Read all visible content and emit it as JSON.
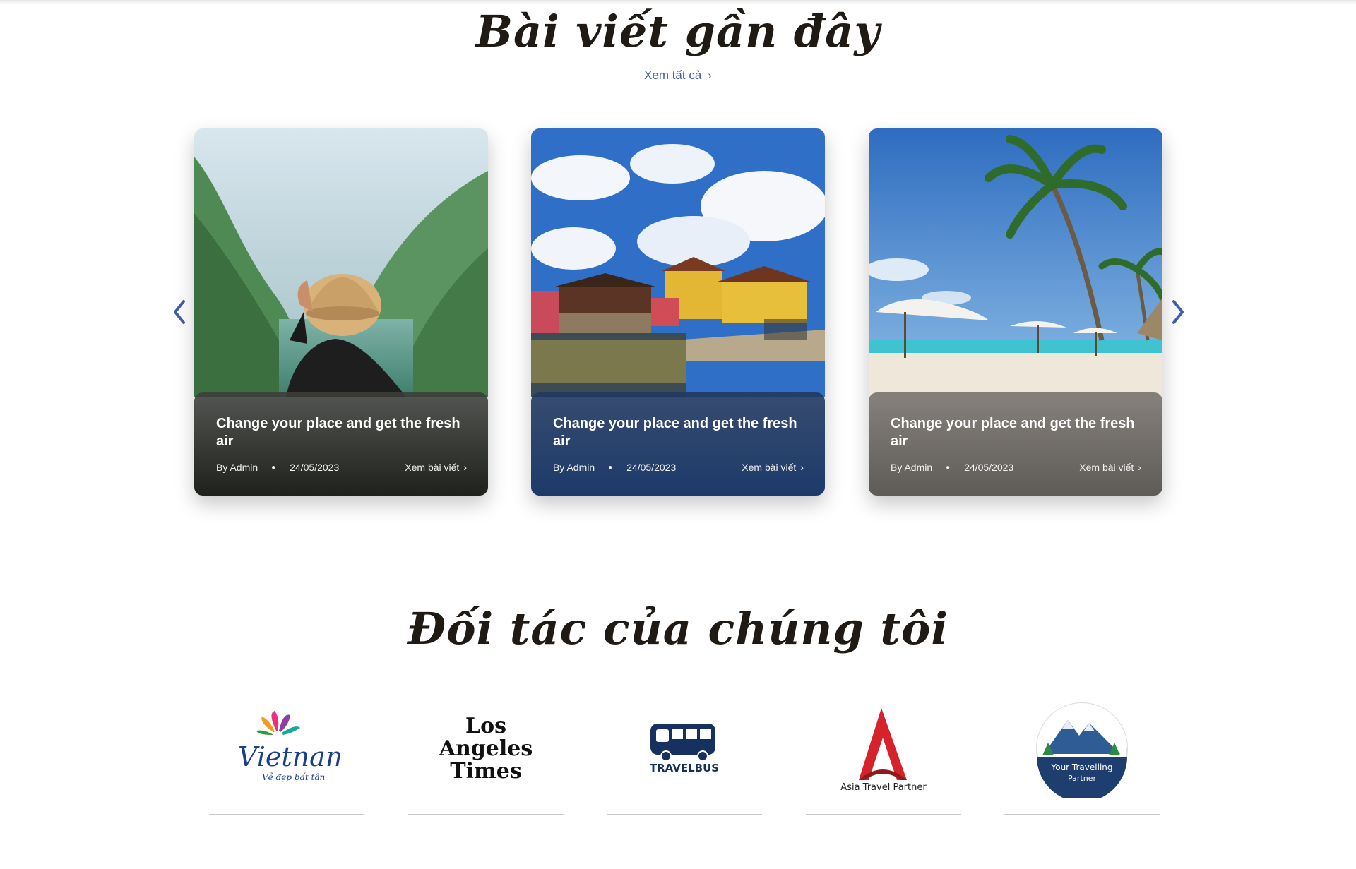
{
  "recent_posts": {
    "title": "Bài viết gần đây",
    "view_all": "Xem tất cả",
    "posts": [
      {
        "title": "Change your place and get the fresh air",
        "author": "By Admin",
        "date": "24/05/2023",
        "read_more": "Xem bài viết"
      },
      {
        "title": "Change your place and get the fresh air",
        "author": "By Admin",
        "date": "24/05/2023",
        "read_more": "Xem bài viết"
      },
      {
        "title": "Change your place and get the fresh air",
        "author": "By Admin",
        "date": "24/05/2023",
        "read_more": "Xem bài viết"
      }
    ]
  },
  "partners": {
    "title": "Đối tác của chúng tôi",
    "logos": [
      {
        "name": "Vietnam",
        "tagline": "Vẻ đẹp bất tận"
      },
      {
        "name": "Los Angeles Times"
      },
      {
        "name": "TRAVELBUS"
      },
      {
        "name": "Asia Travel Partner"
      },
      {
        "name": "Your Travelling",
        "tagline": "Partner"
      }
    ]
  },
  "colors": {
    "accent": "#3f5fae",
    "heading": "#1f1a14",
    "divider": "#c9c9c9"
  },
  "icons": {
    "prev": "chevron-left-icon",
    "next": "chevron-right-icon"
  }
}
